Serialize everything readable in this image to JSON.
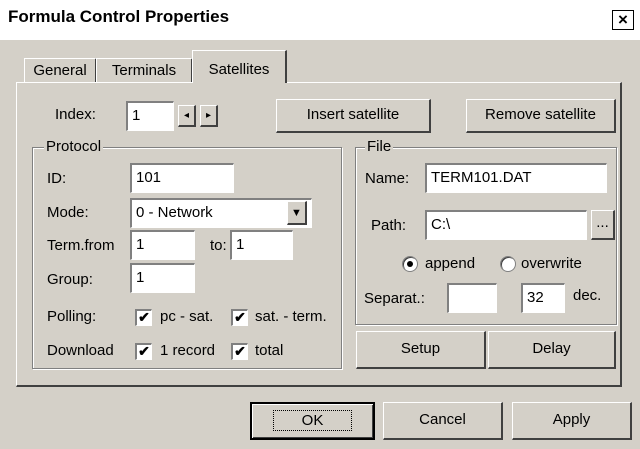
{
  "window": {
    "title": "Formula Control Properties",
    "close_glyph": "×"
  },
  "tabs": [
    {
      "label": "General"
    },
    {
      "label": "Terminals"
    },
    {
      "label": "Satellites"
    }
  ],
  "index": {
    "label": "Index:",
    "value": "1",
    "prev_glyph": "◂",
    "next_glyph": "▸"
  },
  "actions": {
    "insert_label": "Insert satellite",
    "remove_label": "Remove satellite"
  },
  "protocol": {
    "group_label": "Protocol",
    "id_label": "ID:",
    "id_value": "101",
    "mode_label": "Mode:",
    "mode_value": "0 - Network",
    "dropdown_glyph": "▼",
    "term_from_label": "Term.from",
    "term_from_value": "1",
    "to_label": "to:",
    "to_value": "1",
    "group_field_label": "Group:",
    "group_value": "1",
    "polling_label": "Polling:",
    "pc_sat_label": "pc - sat.",
    "sat_term_label": "sat. - term.",
    "download_label": "Download",
    "one_record_label": "1 record",
    "total_label": "total",
    "check_glyph": "✔"
  },
  "file": {
    "group_label": "File",
    "name_label": "Name:",
    "name_value": "TERM101.DAT",
    "path_label": "Path:",
    "path_value": "C:\\",
    "browse_label": "...",
    "append_label": "append",
    "overwrite_label": "overwrite",
    "separat_label": "Separat.:",
    "separat_value": "",
    "sep_code_value": "32",
    "dec_label": "dec."
  },
  "panel_buttons": {
    "setup_label": "Setup",
    "delay_label": "Delay"
  },
  "footer": {
    "ok_label": "OK",
    "cancel_label": "Cancel",
    "apply_label": "Apply"
  }
}
